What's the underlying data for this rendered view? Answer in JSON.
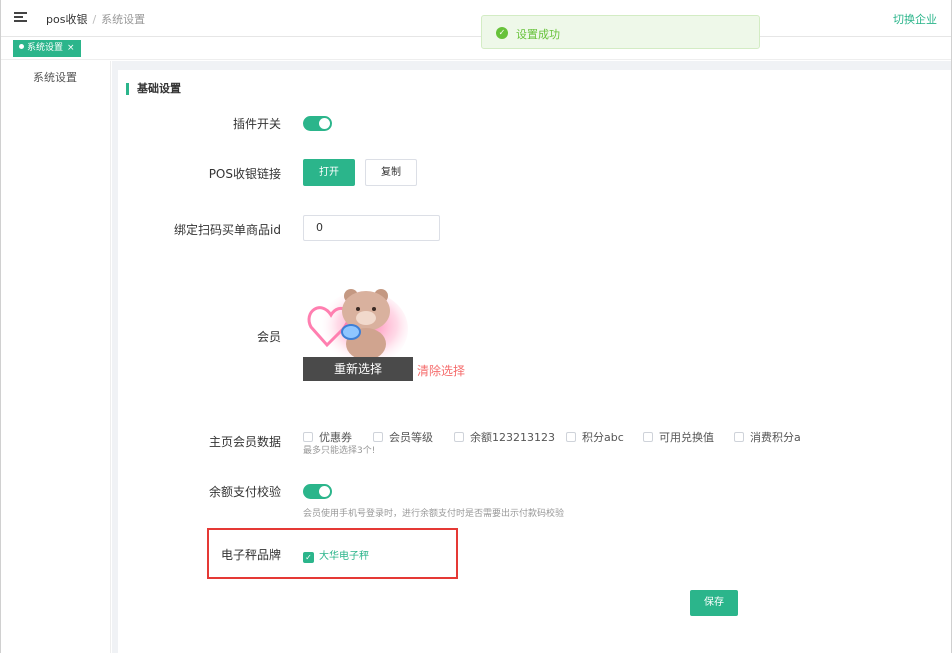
{
  "header": {
    "breadcrumb_root": "pos收银",
    "breadcrumb_sep": "/",
    "breadcrumb_current": "系统设置",
    "switch_enterprise": "切换企业"
  },
  "tabs": [
    {
      "label": "系统设置",
      "close": "×"
    }
  ],
  "toast": {
    "message": "设置成功",
    "icon": "check-circle-icon"
  },
  "sidebar": {
    "items": [
      {
        "label": "系统设置"
      }
    ]
  },
  "section": {
    "title": "基础设置"
  },
  "form": {
    "plugin_switch": {
      "label": "插件开关",
      "on": true
    },
    "pos_link": {
      "label": "POS收银链接",
      "open_button": "打开",
      "copy_button": "复制"
    },
    "bind_goods": {
      "label": "绑定扫码买单商品id",
      "value": "0"
    },
    "member": {
      "label": "会员",
      "reselect": "重新选择",
      "clear": "清除选择"
    },
    "home_member_data": {
      "label": "主页会员数据",
      "options": [
        "优惠券",
        "会员等级",
        "余额123213123",
        "积分abc",
        "可用兑换值",
        "消费积分a"
      ],
      "hint": "最多只能选择3个!"
    },
    "balance_verify": {
      "label": "余额支付校验",
      "on": true,
      "hint": "会员使用手机号登录时，进行余额支付时是否需要出示付款码校验"
    },
    "scale_brand": {
      "label": "电子秤品牌",
      "option": "大华电子秤",
      "checked": true
    },
    "save_button": "保存"
  },
  "colors": {
    "accent": "#2bb58b",
    "danger": "#f56c6c",
    "success": "#67c23a"
  }
}
